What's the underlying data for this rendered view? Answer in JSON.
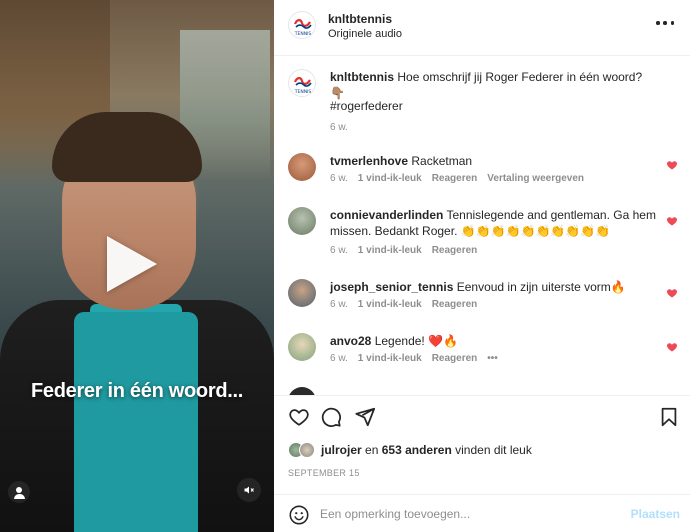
{
  "video": {
    "caption": "Federer in één woord..."
  },
  "header": {
    "username": "knltbtennis",
    "subtitle": "Originele audio",
    "logo_text": "TENNIS"
  },
  "post": {
    "username": "knltbtennis",
    "text": "Hoe omschrijf jij Roger Federer in één woord? 👇🏽",
    "hashtag": "#rogerfederer",
    "time": "6 w."
  },
  "comments": [
    {
      "username": "tvmerlenhove",
      "text": "Racketman",
      "time": "6 w.",
      "likes": "1 vind-ik-leuk",
      "reply": "Reageren",
      "translate": "Vertaling weergeven",
      "avatar_color": "#b87b5a"
    },
    {
      "username": "connievanderlinden",
      "text": "Tennislegende and gentleman. Ga hem missen. Bedankt Roger. 👏👏👏👏👏👏👏👏👏👏",
      "time": "6 w.",
      "likes": "1 vind-ik-leuk",
      "reply": "Reageren",
      "avatar_color": "#8a9a86"
    },
    {
      "username": "joseph_senior_tennis",
      "text": "Eenvoud in zijn uiterste vorm🔥",
      "time": "6 w.",
      "likes": "1 vind-ik-leuk",
      "reply": "Reageren",
      "avatar_color": "#6b7f8a"
    },
    {
      "username": "anvo28",
      "text": "Legende! ❤️🔥",
      "time": "6 w.",
      "likes": "1 vind-ik-leuk",
      "reply": "Reageren",
      "more": "•••",
      "avatar_color": "#9cb89a"
    }
  ],
  "likes": {
    "liked_by": "julrojer",
    "and_text": "en",
    "others": "653 anderen",
    "suffix": "vinden dit leuk"
  },
  "date": "SEPTEMBER 15",
  "add_comment": {
    "placeholder": "Een opmerking toevoegen...",
    "post_label": "Plaatsen"
  },
  "colors": {
    "heart_red": "#ed4956",
    "accent_blue_disabled": "#b2dffc",
    "hashtag_blue": "#00376b",
    "secondary_text": "#8e8e8e"
  }
}
